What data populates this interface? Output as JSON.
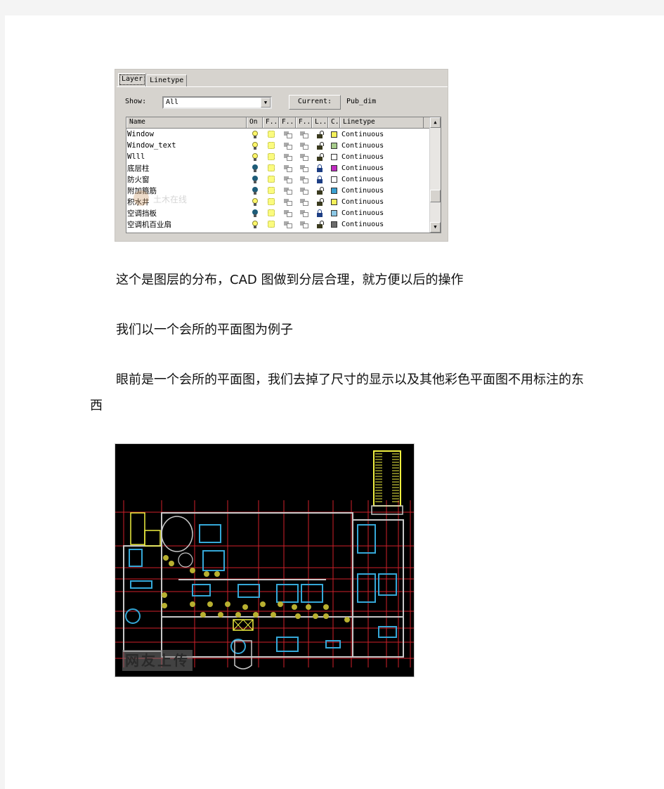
{
  "layer_dialog": {
    "tabs": [
      {
        "label": "Layer",
        "active": true
      },
      {
        "label": "Linetype",
        "active": false
      }
    ],
    "show_label": "Show:",
    "show_value": "All",
    "current_button": "Current:",
    "current_value": "Pub_dim",
    "columns": [
      "Name",
      "On",
      "F..",
      "F..",
      "F..",
      "L..",
      "C..",
      "Linetype"
    ],
    "rows": [
      {
        "name": "Window",
        "on": true,
        "locked": false,
        "color": "#f4f05a",
        "linetype": "Continuous"
      },
      {
        "name": "Window_text",
        "on": true,
        "locked": false,
        "color": "#a7cc8c",
        "linetype": "Continuous"
      },
      {
        "name": "Wlll",
        "on": true,
        "locked": false,
        "color": "#ffffff",
        "linetype": "Continuous"
      },
      {
        "name": "底层柱",
        "on": false,
        "locked": true,
        "color": "#c02cc0",
        "linetype": "Continuous"
      },
      {
        "name": "防火窗",
        "on": false,
        "locked": true,
        "color": "#ffffff",
        "linetype": "Continuous"
      },
      {
        "name": "附加箍筋",
        "on": false,
        "locked": false,
        "color": "#3a9fd0",
        "linetype": "Continuous"
      },
      {
        "name": "积水井",
        "on": true,
        "locked": false,
        "color": "#f4f05a",
        "linetype": "Continuous"
      },
      {
        "name": "空调挡板",
        "on": false,
        "locked": true,
        "color": "#8cc8e6",
        "linetype": "Continuous"
      },
      {
        "name": "空调机百业扇",
        "on": true,
        "locked": false,
        "color": "#6b6b6b",
        "linetype": "Continuous"
      }
    ],
    "watermark": "土木在线"
  },
  "paragraphs": [
    "这个是图层的分布，CAD 图做到分层合理，就方便以后的操作",
    "我们以一个会所的平面图为例子",
    "眼前是一个会所的平面图，我们去掉了尺寸的显示以及其他彩色平面图不用标注的东",
    "西"
  ],
  "cad_image": {
    "watermark": "网友上传",
    "colors": {
      "grid": "#d0202a",
      "walls": "#c8c8c8",
      "furniture": "#35a8d8",
      "plants": "#b8b030",
      "stairs": "#f0f040"
    }
  }
}
